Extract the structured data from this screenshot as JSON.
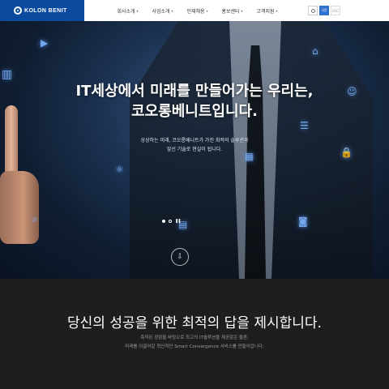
{
  "header": {
    "logo_text": "KOLON BENIT",
    "nav": [
      {
        "label": "회사소개"
      },
      {
        "label": "사업소개"
      },
      {
        "label": "인재채용"
      },
      {
        "label": "홍보센터"
      },
      {
        "label": "고객지원"
      }
    ],
    "lang_active": "국문",
    "lang_inactive": "ENG",
    "colors": {
      "brand": "#0a4ba0",
      "accent": "#2f6fce"
    }
  },
  "hero": {
    "title_line1": "IT세상에서 미래를 만들어가는 우리는,",
    "title_line2": "코오롱베니트입니다.",
    "sub_line1": "상상하는 미래, 코오롱베니트가 가진 최적의 솔루션과",
    "sub_line2": "앞선 기술로 현실이 됩니다.",
    "slide_count": 2,
    "active_slide": 1
  },
  "section": {
    "title": "당신의 성공을 위한 최적의 답을 제시합니다.",
    "desc_line1": "축적된 경험을 바탕으로 최고의 IT솔루션을 제공함은 물론,",
    "desc_line2": "미래를 이끌어갈 혁신적인 Smart Convergence 서비스를 만들어갑니다."
  }
}
